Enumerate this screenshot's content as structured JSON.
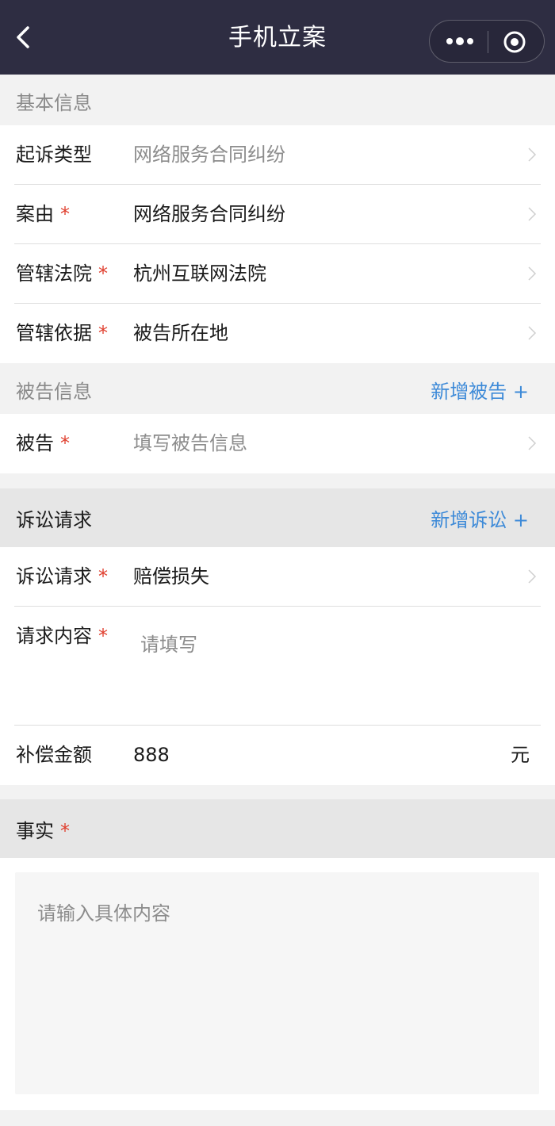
{
  "nav": {
    "title": "手机立案"
  },
  "basic": {
    "header": "基本信息",
    "rows": [
      {
        "label": "起诉类型",
        "required": false,
        "value": "网络服务合同纠纷",
        "placeholder": true
      },
      {
        "label": "案由",
        "required": true,
        "value": "网络服务合同纠纷",
        "placeholder": false
      },
      {
        "label": "管辖法院",
        "required": true,
        "value": "杭州互联网法院",
        "placeholder": false
      },
      {
        "label": "管辖依据",
        "required": true,
        "value": "被告所在地",
        "placeholder": false
      }
    ]
  },
  "defendant": {
    "header": "被告信息",
    "add_label": "新增被告 +",
    "row": {
      "label": "被告",
      "required": true,
      "value": "填写被告信息"
    }
  },
  "claims": {
    "header": "诉讼请求",
    "add_label": "新增诉讼 +",
    "claim_row": {
      "label": "诉讼请求",
      "value": "赔偿损失"
    },
    "content_row": {
      "label": "请求内容",
      "placeholder": "请填写"
    },
    "amount_row": {
      "label": "补偿金额",
      "value": "888",
      "unit": "元"
    }
  },
  "facts": {
    "header": "事实",
    "placeholder": "请输入具体内容"
  },
  "required_mark": "*",
  "colors": {
    "nav_bg": "#2e2d42",
    "accent": "#3d8ad8",
    "required": "#e0402f"
  }
}
